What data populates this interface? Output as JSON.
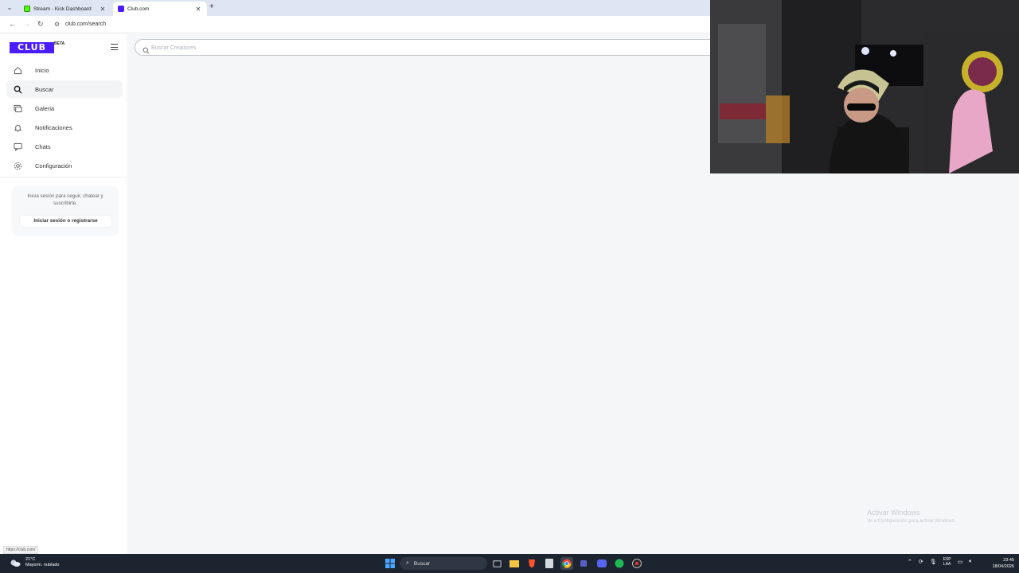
{
  "browser": {
    "tabs": [
      {
        "title": "Stream - Kick Dashboard",
        "favicon": "kick-icon",
        "active": false
      },
      {
        "title": "Club.com",
        "favicon": "club-icon",
        "active": true
      }
    ],
    "url": "club.com/search",
    "status_url": "https://club.com/"
  },
  "sidebar": {
    "logo": "CLUB",
    "logo_badge": "BETA",
    "nav": [
      {
        "label": "Inicio",
        "icon": "home-icon",
        "active": false
      },
      {
        "label": "Buscar",
        "icon": "search-icon",
        "active": true
      },
      {
        "label": "Galeria",
        "icon": "gallery-icon",
        "active": false
      },
      {
        "label": "Notificaciones",
        "icon": "bell-icon",
        "active": false
      },
      {
        "label": "Chats",
        "icon": "chat-icon",
        "active": false
      },
      {
        "label": "Configuración",
        "icon": "gear-icon",
        "active": false
      }
    ],
    "login_card": {
      "text": "Inicia sesión para seguir, chatear y suscribirte.",
      "button": "Iniciar sesión o registrarse"
    }
  },
  "main": {
    "search": {
      "placeholder": "Buscar Creadores",
      "value": ""
    }
  },
  "watermark": {
    "title": "Activar Windows",
    "subtitle": "Ve a Configuración para activar Windows."
  },
  "taskbar": {
    "weather_temp": "21°C",
    "weather_desc": "Mayorm. nublado",
    "search_label": "Buscar",
    "lang_top": "ESP",
    "lang_bottom": "LAA",
    "time": "23:45",
    "date": "18/04/2026"
  },
  "colors": {
    "brand": "#4b1cff",
    "main_bg": "#f5f6f8",
    "taskbar": "#1c2430"
  }
}
